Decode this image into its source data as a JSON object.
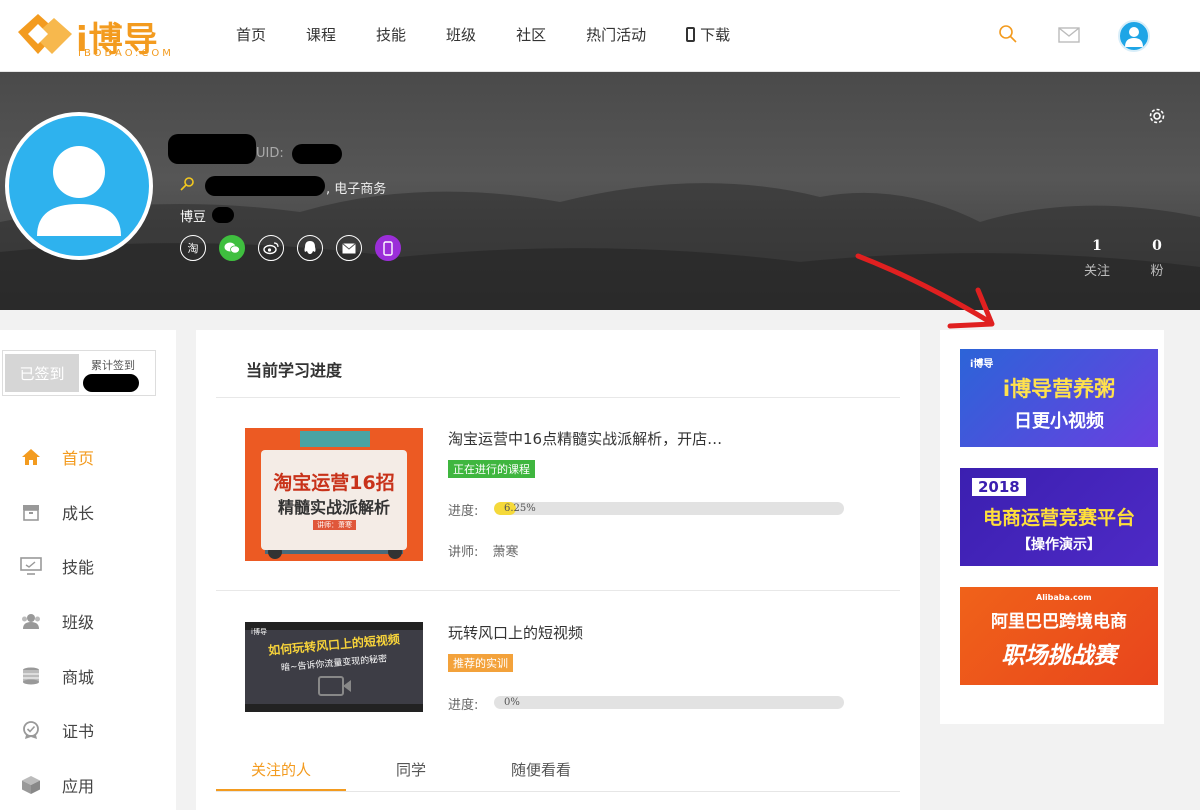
{
  "logo": {
    "text": "i博导",
    "sub": "IBODAO.COM"
  },
  "nav": {
    "items": [
      "首页",
      "课程",
      "技能",
      "班级",
      "社区",
      "热门活动"
    ],
    "download": "下载"
  },
  "profile": {
    "uid_label": "UID:",
    "major_suffix": ", 电子商务",
    "beans_label": "博豆",
    "socials": [
      {
        "name": "taobao",
        "glyph": "淘"
      },
      {
        "name": "wechat",
        "glyph": ""
      },
      {
        "name": "weibo",
        "glyph": ""
      },
      {
        "name": "qq",
        "glyph": ""
      },
      {
        "name": "mail",
        "glyph": ""
      },
      {
        "name": "mobile",
        "glyph": ""
      }
    ],
    "following": {
      "count": "1",
      "label": "关注"
    },
    "fans": {
      "count": "0",
      "label": "粉"
    }
  },
  "sidebar": {
    "signin_button": "已签到",
    "signin_total_label": "累计签到",
    "menu": [
      "首页",
      "成长",
      "技能",
      "班级",
      "商城",
      "证书",
      "应用"
    ]
  },
  "main": {
    "title": "当前学习进度",
    "courses": [
      {
        "title": "淘宝运营中16点精髓实战派解析，开店…",
        "tag": "正在进行的课程",
        "progress_label": "进度:",
        "progress_text": "6.25%",
        "progress": 6.25,
        "teacher_label": "讲师:",
        "teacher": "萧寒",
        "thumb_line1": "淘宝运营16招",
        "thumb_line2": "精髓实战派解析",
        "thumb_badge": "讲师：萧寒"
      },
      {
        "title": "玩转风口上的短视频",
        "tag": "推荐的实训",
        "progress_label": "进度:",
        "progress_text": "0%",
        "progress": 0,
        "thumb_logo": "i博导",
        "thumb_line1": "如何玩转风口上的短视频",
        "thumb_line2": "暗~告诉你流量变现的秘密"
      }
    ],
    "tabs": [
      "关注的人",
      "同学",
      "随便看看"
    ]
  },
  "ads": [
    {
      "logo": "i博导",
      "line1": "i博导营养粥",
      "line2": "日更小视频"
    },
    {
      "year": "2018",
      "line1": "电商运营竞赛平台",
      "line2": "【操作演示】"
    },
    {
      "brand": "Alibaba.com",
      "line1": "阿里巴巴跨境电商",
      "line2": "职场挑战赛"
    }
  ],
  "colors": {
    "accent": "#f39b1f",
    "avatar": "#2eb2ee",
    "tag_green": "#3fb63f",
    "tag_orange": "#f3a23b"
  }
}
